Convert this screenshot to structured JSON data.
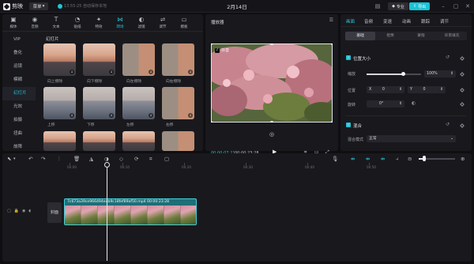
{
  "app": {
    "name": "剪映"
  },
  "titlebar": {
    "menu_label": "菜单",
    "save_status": "13:55:25 自动保存本地",
    "project_title": "2月14日",
    "pro_label": "专业",
    "export_label": "导出"
  },
  "toolbar": {
    "tools": [
      {
        "label": "媒体",
        "icon": "media-icon"
      },
      {
        "label": "音频",
        "icon": "audio-icon"
      },
      {
        "label": "文本",
        "icon": "text-icon"
      },
      {
        "label": "贴纸",
        "icon": "sticker-icon"
      },
      {
        "label": "特效",
        "icon": "effects-icon"
      },
      {
        "label": "转场",
        "icon": "transition-icon"
      },
      {
        "label": "滤镜",
        "icon": "filter-icon"
      },
      {
        "label": "调节",
        "icon": "adjust-icon"
      },
      {
        "label": "模板",
        "icon": "template-icon"
      }
    ]
  },
  "categories": [
    "VIP",
    "叠化",
    "运镜",
    "模糊",
    "幻灯片",
    "光效",
    "拍摄",
    "扭曲",
    "故障"
  ],
  "section_title": "幻灯片",
  "transitions": [
    {
      "label": "向上擦除"
    },
    {
      "label": "向下擦除"
    },
    {
      "label": "向左擦除"
    },
    {
      "label": "向右擦除"
    },
    {
      "label": "上移"
    },
    {
      "label": "下移"
    },
    {
      "label": "左移"
    },
    {
      "label": "右移"
    }
  ],
  "player": {
    "title": "播放器",
    "watermark": "抖音",
    "current_time": "00:00:07:21",
    "total_time": "00:00:23:28"
  },
  "properties": {
    "tabs": [
      "画面",
      "音频",
      "变速",
      "动画",
      "跟踪",
      "调节"
    ],
    "subtabs": [
      "基础",
      "抠像",
      "蒙版",
      "背景填充"
    ],
    "position_size_title": "位置大小",
    "scale_label": "缩放",
    "scale_value": "100%",
    "scale_fraction": 1.0,
    "position_label": "位置",
    "pos_x_prefix": "X",
    "pos_x": "0",
    "pos_y_prefix": "Y",
    "pos_y": "0",
    "rotation_label": "旋转",
    "rotation_value": "0°",
    "blend_title": "混合",
    "blend_mode_label": "混合模式",
    "blend_mode_value": "正常"
  },
  "timeline": {
    "ticks": [
      "00:00",
      "00:10",
      "00:20",
      "00:30",
      "00:40",
      "00:50"
    ],
    "cover_label": "封面",
    "clip_label": "7c673a39ce966494eab9c18fef89af50.mp4   00:00:23:28"
  },
  "colors": {
    "accent": "#28c6d8",
    "export": "#18c3d6",
    "clip": "#1e6f77"
  }
}
